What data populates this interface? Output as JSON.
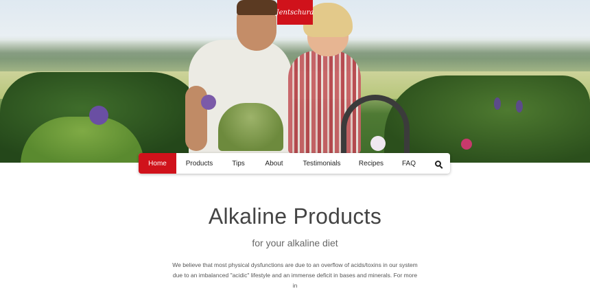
{
  "brand": {
    "logo_text": "Jentschura",
    "accent_color": "#d0121b"
  },
  "nav": {
    "items": [
      {
        "label": "Home",
        "active": true
      },
      {
        "label": "Products",
        "active": false
      },
      {
        "label": "Tips",
        "active": false
      },
      {
        "label": "About",
        "active": false
      },
      {
        "label": "Testimonials",
        "active": false
      },
      {
        "label": "Recipes",
        "active": false
      },
      {
        "label": "FAQ",
        "active": false
      }
    ],
    "search_icon": "search-icon"
  },
  "content": {
    "title": "Alkaline Products",
    "subtitle": "for your alkaline diet",
    "intro_line1": "We believe that most physical dysfunctions are due to an overflow of acids/toxins in our system",
    "intro_line2": "due to an imbalanced \"acidic\" lifestyle and an immense deficit in bases and minerals. For more in"
  }
}
